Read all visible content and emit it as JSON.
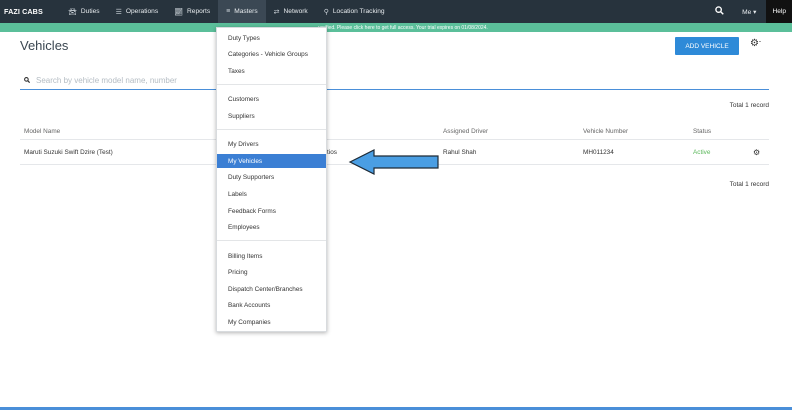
{
  "navbar": {
    "brand": "FAZI CABS",
    "items": [
      {
        "label": "Duties",
        "icon": "car-icon"
      },
      {
        "label": "Operations",
        "icon": "list-icon"
      },
      {
        "label": "Reports",
        "icon": "chart-icon"
      },
      {
        "label": "Masters",
        "icon": "stack-icon"
      },
      {
        "label": "Network",
        "icon": "shuffle-icon"
      },
      {
        "label": "Location Tracking",
        "icon": "map-marker-icon"
      }
    ],
    "me_label": "Me",
    "help_label": "Help"
  },
  "banner": {
    "text": "verified. Please click here to get full access. Your trial expires on 01/08/2024."
  },
  "page": {
    "title": "Vehicles",
    "add_button": "ADD VEHICLE",
    "search_placeholder": "Search by vehicle model name, number",
    "total_top": "Total 1 record",
    "total_bottom": "Total 1 record"
  },
  "table": {
    "columns": [
      "Model Name",
      "Assigned Driver",
      "Vehicle Number",
      "Status"
    ],
    "rows": [
      {
        "model_name": "Maruti Suzuki Swift Dzire (Test)",
        "category_fragment": "tios",
        "assigned_driver": "Rahul Shah",
        "vehicle_number": "MH011234",
        "status": "Active"
      }
    ]
  },
  "masters_menu": {
    "groups": [
      [
        "Duty Types",
        "Categories - Vehicle Groups",
        "Taxes"
      ],
      [
        "Customers",
        "Suppliers"
      ],
      [
        "My Drivers",
        "My Vehicles",
        "Duty Supporters",
        "Labels",
        "Feedback Forms",
        "Employees"
      ],
      [
        "Billing Items",
        "Pricing",
        "Dispatch Center/Branches",
        "Bank Accounts",
        "My Companies"
      ]
    ],
    "active_item": "My Vehicles"
  },
  "colors": {
    "navbar_bg": "#27333d",
    "banner_bg": "#5bbf9a",
    "accent": "#2e8ad8",
    "menu_active": "#3b7fd4",
    "arrow_fill": "#4a9ee3",
    "status_active": "#5cb85c"
  }
}
